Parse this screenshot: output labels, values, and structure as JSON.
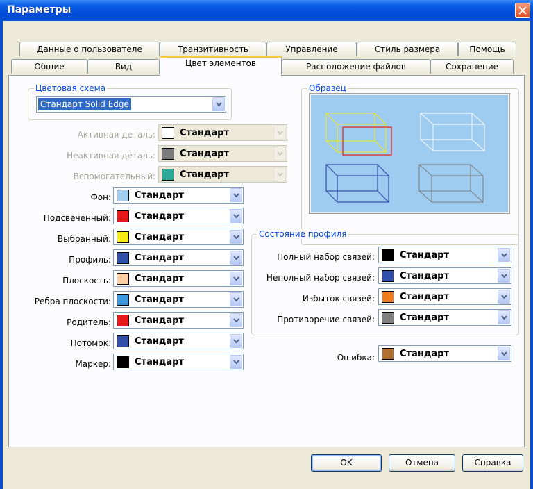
{
  "window": {
    "title": "Параметры"
  },
  "tabs_back": [
    {
      "label": "Данные о пользователе"
    },
    {
      "label": "Транзитивность"
    },
    {
      "label": "Управление"
    },
    {
      "label": "Стиль размера"
    },
    {
      "label": "Помощь"
    }
  ],
  "tabs_front": [
    {
      "label": "Общие"
    },
    {
      "label": "Вид"
    },
    {
      "label": "Цвет элементов"
    },
    {
      "label": "Расположение файлов"
    },
    {
      "label": "Сохранение"
    }
  ],
  "color_scheme": {
    "group_label": "Цветовая схема",
    "selected": "Стандарт Solid Edge"
  },
  "part_colors": [
    {
      "label": "Активная деталь:",
      "value": "Стандарт",
      "swatch": "#ffffff"
    },
    {
      "label": "Неактивная деталь:",
      "value": "Стандарт",
      "swatch": "#7a7a7a"
    },
    {
      "label": "Вспомогательный:",
      "value": "Стандарт",
      "swatch": "#2aa898"
    }
  ],
  "element_colors": [
    {
      "label": "Фон:",
      "value": "Стандарт",
      "swatch": "#9fcef0"
    },
    {
      "label": "Подсвеченный:",
      "value": "Стандарт",
      "swatch": "#e81818"
    },
    {
      "label": "Выбранный:",
      "value": "Стандарт",
      "swatch": "#f5ec16"
    },
    {
      "label": "Профиль:",
      "value": "Стандарт",
      "swatch": "#2f4fa8"
    },
    {
      "label": "Плоскость:",
      "value": "Стандарт",
      "swatch": "#fdd0a4"
    },
    {
      "label": "Ребра плоскости:",
      "value": "Стандарт",
      "swatch": "#3a98e0"
    },
    {
      "label": "Родитель:",
      "value": "Стандарт",
      "swatch": "#e81818"
    },
    {
      "label": "Потомок:",
      "value": "Стандарт",
      "swatch": "#2f4fa8"
    },
    {
      "label": "Маркер:",
      "value": "Стандарт",
      "swatch": "#000000"
    }
  ],
  "sample": {
    "group_label": "Образец"
  },
  "profile_state": {
    "group_label": "Состояние профиля",
    "rows": [
      {
        "label": "Полный набор связей:",
        "value": "Стандарт",
        "swatch": "#000000"
      },
      {
        "label": "Неполный набор связей:",
        "value": "Стандарт",
        "swatch": "#2f4fa8"
      },
      {
        "label": "Избыток связей:",
        "value": "Стандарт",
        "swatch": "#f07d1c"
      },
      {
        "label": "Противоречие связей:",
        "value": "Стандарт",
        "swatch": "#808080"
      }
    ]
  },
  "error_color": {
    "label": "Ошибка:",
    "value": "Стандарт",
    "swatch": "#b07030"
  },
  "buttons": {
    "ok": "OK",
    "cancel": "Отмена",
    "help": "Справка"
  }
}
